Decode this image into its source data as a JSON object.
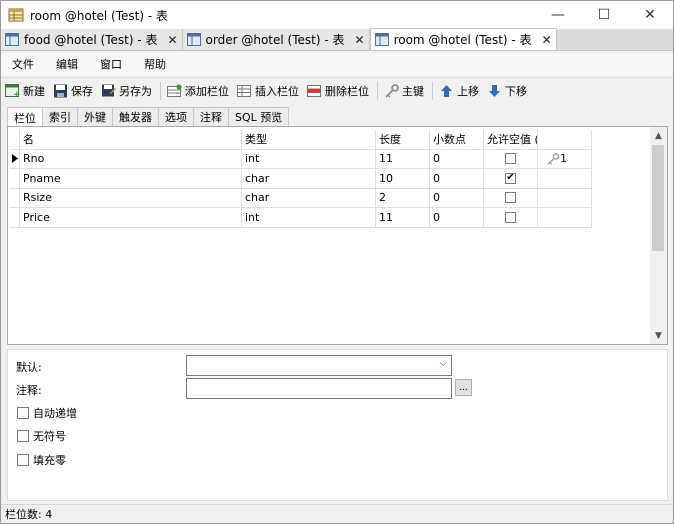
{
  "window": {
    "title": "room @hotel (Test) - 表",
    "controls": {
      "minimize": "—",
      "maximize": "☐",
      "close": "✕"
    }
  },
  "doc_tabs": [
    {
      "label": "food @hotel (Test) - 表",
      "close": "✕",
      "active": false
    },
    {
      "label": "order @hotel (Test) - 表",
      "close": "✕",
      "active": false
    },
    {
      "label": "room @hotel (Test) - 表",
      "close": "✕",
      "active": true
    }
  ],
  "menu": [
    "文件",
    "编辑",
    "窗口",
    "帮助"
  ],
  "toolbar": {
    "new": "新建",
    "save": "保存",
    "save_as": "另存为",
    "add_field": "添加栏位",
    "insert_field": "插入栏位",
    "delete_field": "删除栏位",
    "primary_key": "主键",
    "move_up": "上移",
    "move_down": "下移"
  },
  "sub_tabs": [
    "栏位",
    "索引",
    "外键",
    "触发器",
    "选项",
    "注释",
    "SQL 预览"
  ],
  "grid": {
    "headers": {
      "name": "名",
      "type": "类型",
      "length": "长度",
      "decimals": "小数点",
      "not_null": "允许空值 (",
      "key": ""
    },
    "rows": [
      {
        "name": "Rno",
        "type": "int",
        "length": "11",
        "decimals": "0",
        "nullable": false,
        "key": "1",
        "indicator": true
      },
      {
        "name": "Pname",
        "type": "char",
        "length": "10",
        "decimals": "0",
        "nullable": true,
        "key": "",
        "indicator": false
      },
      {
        "name": "Rsize",
        "type": "char",
        "length": "2",
        "decimals": "0",
        "nullable": false,
        "key": "",
        "indicator": false
      },
      {
        "name": "Price",
        "type": "int",
        "length": "11",
        "decimals": "0",
        "nullable": false,
        "key": "",
        "indicator": false
      }
    ]
  },
  "props": {
    "default_label": "默认:",
    "default_value": "",
    "comment_label": "注释:",
    "comment_value": "",
    "browse_button": "...",
    "auto_increment": "自动递增",
    "unsigned": "无符号",
    "zerofill": "填充零"
  },
  "status": {
    "field_count": "栏位数: 4"
  }
}
